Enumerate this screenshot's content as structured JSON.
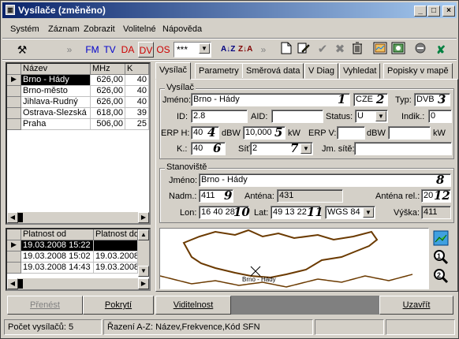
{
  "window": {
    "title": "Vysílače (změněno)",
    "min": "_",
    "max": "□",
    "close": "×"
  },
  "menu": [
    "Systém",
    "Záznam",
    "Zobrazit",
    "Volitelné",
    "Nápověda"
  ],
  "toolbar": {
    "tools": "⚒",
    "chev1": "»",
    "filters": [
      "FM",
      "TV",
      "DA",
      "DV",
      "OS"
    ],
    "filter_colors": [
      "#0000cc",
      "#0000cc",
      "#cc0000",
      "#cc0000",
      "#cc0000"
    ],
    "combo": "***",
    "chev2": "»",
    "sort_az": "A↓Z",
    "sort_za": "Z↓A",
    "actions": [
      "new-icon",
      "edit-icon",
      "confirm-icon",
      "cancel-icon",
      "delete-icon",
      "map-icon",
      "export-icon",
      "stop-icon",
      "excel-icon"
    ]
  },
  "list": {
    "headers": [
      "Název",
      "MHz",
      "K"
    ],
    "rows": [
      [
        "Brno - Hády",
        "626,00",
        "40"
      ],
      [
        "Brno-město",
        "626,00",
        "40"
      ],
      [
        "Jihlava-Rudný",
        "626,00",
        "40"
      ],
      [
        "Ostrava-Slezská",
        "618,00",
        "39"
      ],
      [
        "Praha",
        "506,00",
        "25"
      ]
    ]
  },
  "validity": {
    "headers": [
      "Platnost od",
      "Platnost do"
    ],
    "rows": [
      [
        "19.03.2008 15:22",
        ""
      ],
      [
        "19.03.2008 15:02",
        "19.03.2008"
      ],
      [
        "19.03.2008 14:43",
        "19.03.2008"
      ]
    ]
  },
  "tabs": [
    "Vysílač",
    "Parametry",
    "Směrová data",
    "V Diag",
    "Vyhledat",
    "Popisky v mapě"
  ],
  "vysilac": {
    "caption": "Vysílač",
    "jmeno_label": "Jméno:",
    "jmeno": "Brno - Hády",
    "n1": "1",
    "country": "CZE",
    "n2": "2",
    "typ_label": "Typ:",
    "typ": "DVB",
    "n3": "3",
    "id_label": "ID:",
    "id": "2.8",
    "aid_label": "AID:",
    "aid": "",
    "status_label": "Status:",
    "status": "U",
    "indik_label": "Indik.:",
    "indik": "0",
    "erph_label": "ERP H:",
    "erph": "40",
    "n4": "4",
    "dbw1": "dBW",
    "erph_kw": "10,000",
    "n5": "5",
    "kw1": "kW",
    "erpv_label": "ERP V:",
    "erpv": "",
    "dbw2": "dBW",
    "erpv_kw": "",
    "kw2": "kW",
    "k_label": "K.:",
    "k": "40",
    "n6": "6",
    "sit_label": "Síť",
    "sit": "2",
    "n7": "7",
    "jmsite_label": "Jm. sítě:",
    "jmsite": ""
  },
  "stanoviste": {
    "caption": "Stanoviště",
    "jmeno_label": "Jméno:",
    "jmeno": "Brno - Hády",
    "n8": "8",
    "nadm_label": "Nadm.:",
    "nadm": "411",
    "n9": "9",
    "antena_label": "Anténa:",
    "antena": "431",
    "antrel_label": "Anténa rel.:",
    "antrel": "20",
    "n12": "12",
    "lon_label": "Lon:",
    "lon": "16 40 28",
    "n10": "10",
    "lat_label": "Lat:",
    "lat": "49 13 22",
    "n11": "11",
    "datum": "WGS 84",
    "vyska_label": "Výška:",
    "vyska": "411"
  },
  "map": {
    "marker_label": "Brno - Hády"
  },
  "buttons": {
    "prenest": "Přenést",
    "pokryti": "Pokrytí",
    "viditelnost": "Viditelnost",
    "uzavrit": "Uzavřít"
  },
  "statusbar": {
    "count": "Počet vysílačů: 5",
    "sort": "Řazení A-Z: Název,Frekvence,Kód SFN"
  }
}
